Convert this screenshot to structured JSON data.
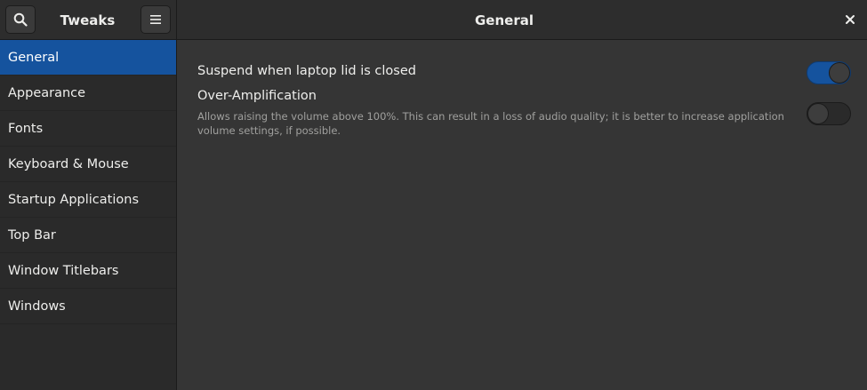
{
  "header": {
    "app_title": "Tweaks",
    "page_title": "General",
    "search_icon": "search-icon",
    "menu_icon": "hamburger-menu-icon",
    "close_icon": "close-icon"
  },
  "sidebar": {
    "items": [
      {
        "label": "General",
        "selected": true
      },
      {
        "label": "Appearance",
        "selected": false
      },
      {
        "label": "Fonts",
        "selected": false
      },
      {
        "label": "Keyboard & Mouse",
        "selected": false
      },
      {
        "label": "Startup Applications",
        "selected": false
      },
      {
        "label": "Top Bar",
        "selected": false
      },
      {
        "label": "Window Titlebars",
        "selected": false
      },
      {
        "label": "Windows",
        "selected": false
      }
    ]
  },
  "settings": [
    {
      "title": "Suspend when laptop lid is closed",
      "description": "",
      "enabled": true
    },
    {
      "title": "Over-Amplification",
      "description": "Allows raising the volume above 100%. This can result in a loss of audio quality; it is better to increase application volume settings, if possible.",
      "enabled": false
    }
  ],
  "colors": {
    "accent": "#15539e",
    "background": "#353535",
    "sidebar": "#2a2a2a"
  }
}
